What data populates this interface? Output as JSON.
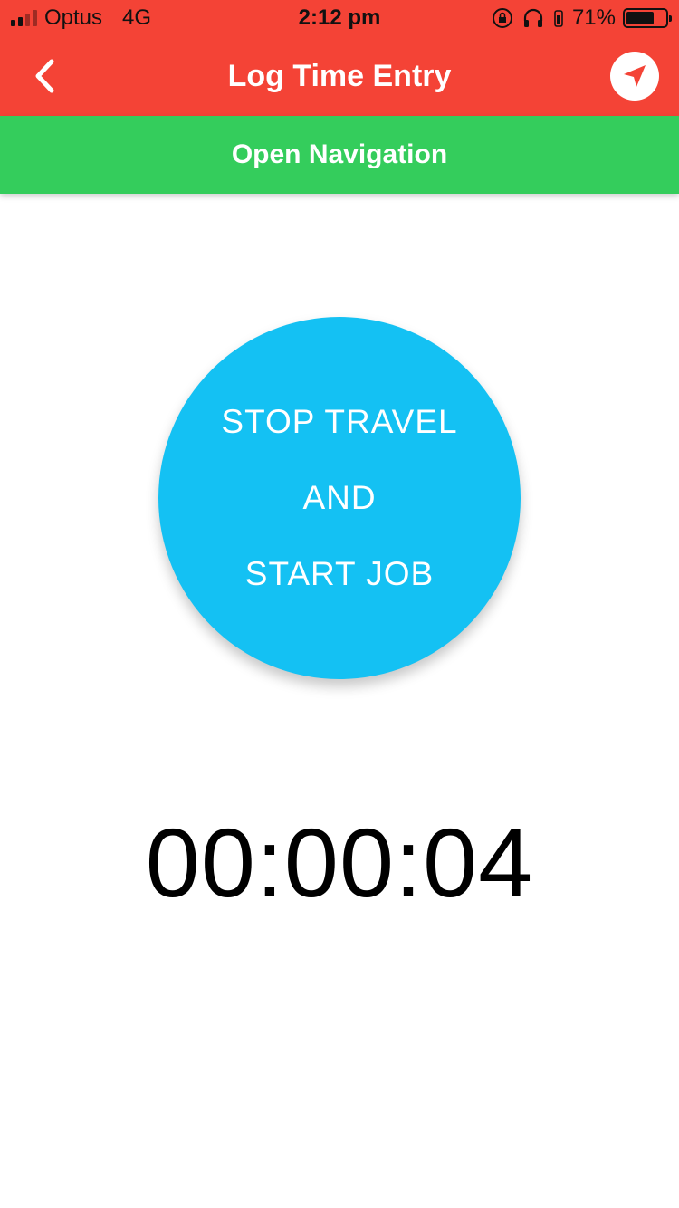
{
  "status_bar": {
    "carrier": "Optus",
    "network": "4G",
    "time": "2:12 pm",
    "battery_percent": "71%",
    "battery_level": 0.71,
    "icons": [
      "signal-icon",
      "rotation-lock-icon",
      "headphones-icon",
      "battery-icon"
    ]
  },
  "header": {
    "title": "Log Time Entry",
    "back_icon": "chevron-left-icon",
    "navigate_icon": "navigation-arrow-icon"
  },
  "navigation_bar": {
    "label": "Open Navigation"
  },
  "action_button": {
    "line1": "STOP TRAVEL",
    "line2": "AND",
    "line3": "START JOB"
  },
  "timer": {
    "value": "00:00:04"
  },
  "colors": {
    "header_bg": "#f44336",
    "navigation_bg": "#34cd5c",
    "action_button_bg": "#14c1f3",
    "text_light": "#ffffff",
    "text_dark": "#000000"
  }
}
